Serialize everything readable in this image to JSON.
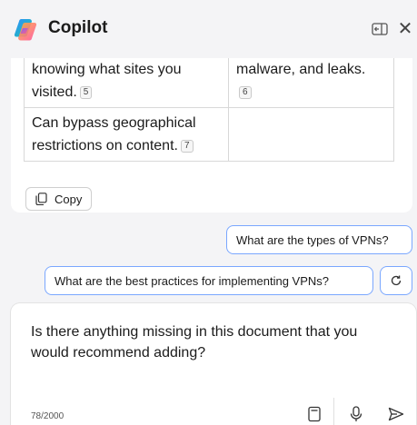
{
  "header": {
    "title": "Copilot",
    "close_glyph": "✕"
  },
  "response": {
    "table_rows": [
      {
        "col1": "service provider from knowing what sites you visited.",
        "col1_cite": "5",
        "col2": "exposure to ads, malware, and leaks.",
        "col2_cite": "6"
      },
      {
        "col1": "Can bypass geographical restrictions on content.",
        "col1_cite": "7",
        "col2": "",
        "col2_cite": ""
      }
    ],
    "copy_label": "Copy"
  },
  "suggestions": [
    "What are the types of VPNs?",
    "What are the best practices for implementing VPNs?"
  ],
  "input": {
    "text": "Is there anything missing in this document that you would recommend adding?",
    "char_count": "78/2000"
  },
  "colors": {
    "accent_border": "#7aa7ff",
    "background": "#f4f4f6"
  },
  "icons": {
    "logo": "copilot-logo",
    "sidebar": "open-sidebar-icon",
    "close": "close-icon",
    "copy": "copy-icon",
    "refresh": "refresh-icon",
    "notebook": "notebook-icon",
    "mic": "microphone-icon",
    "send": "send-icon"
  }
}
